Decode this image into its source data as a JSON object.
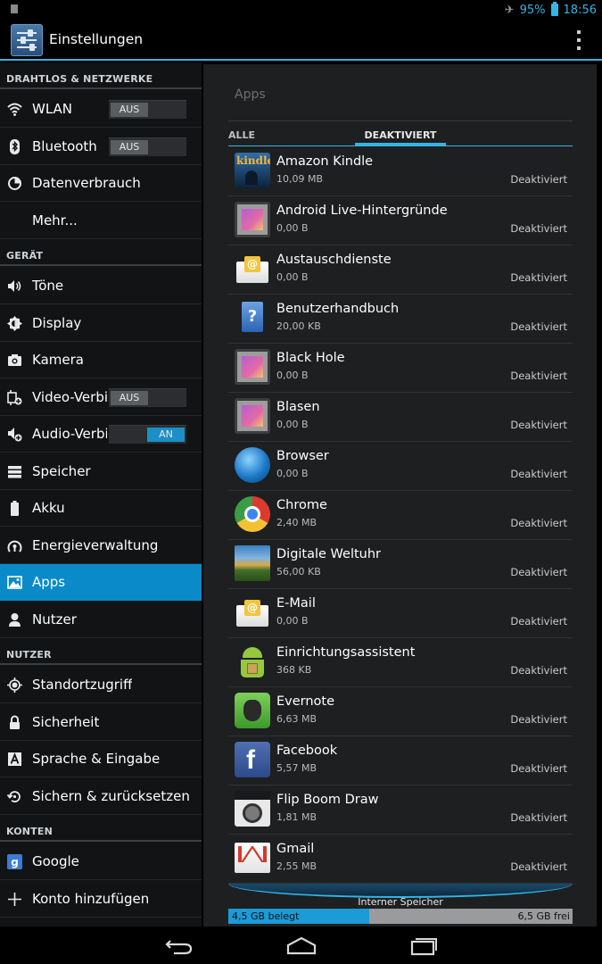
{
  "status_bar": {
    "battery": "95%",
    "time": "18:56",
    "icons": [
      "notification-icon",
      "airplane-mode-icon",
      "battery-icon"
    ]
  },
  "action_bar": {
    "title": "Einstellungen",
    "icons": [
      "settings-app-icon",
      "overflow-menu-icon"
    ]
  },
  "sidebar": {
    "sections": [
      {
        "header": "DRAHTLOS & NETZWERKE",
        "items": [
          {
            "label": "WLAN",
            "icon": "wifi-icon",
            "toggle": "AUS",
            "toggle_on": false
          },
          {
            "label": "Bluetooth",
            "icon": "bluetooth-icon",
            "toggle": "AUS",
            "toggle_on": false
          },
          {
            "label": "Datenverbrauch",
            "icon": "data-usage-icon"
          },
          {
            "label": "Mehr...",
            "icon": ""
          }
        ]
      },
      {
        "header": "GERÄT",
        "items": [
          {
            "label": "Töne",
            "icon": "sound-icon"
          },
          {
            "label": "Display",
            "icon": "display-icon"
          },
          {
            "label": "Kamera",
            "icon": "camera-icon"
          },
          {
            "label": "Video-Verbindung",
            "icon": "video-connection-icon",
            "toggle": "AUS",
            "toggle_on": false
          },
          {
            "label": "Audio-Verbindung",
            "icon": "audio-connection-icon",
            "toggle": "AN",
            "toggle_on": true
          },
          {
            "label": "Speicher",
            "icon": "storage-icon"
          },
          {
            "label": "Akku",
            "icon": "battery-icon"
          },
          {
            "label": "Energieverwaltung",
            "icon": "power-management-icon"
          },
          {
            "label": "Apps",
            "icon": "apps-icon",
            "active": true
          },
          {
            "label": "Nutzer",
            "icon": "user-icon"
          }
        ]
      },
      {
        "header": "NUTZER",
        "items": [
          {
            "label": "Standortzugriff",
            "icon": "location-icon"
          },
          {
            "label": "Sicherheit",
            "icon": "lock-icon"
          },
          {
            "label": "Sprache & Eingabe",
            "icon": "language-icon"
          },
          {
            "label": "Sichern & zurücksetzen",
            "icon": "backup-icon"
          }
        ]
      },
      {
        "header": "KONTEN",
        "items": [
          {
            "label": "Google",
            "icon": "google-icon"
          },
          {
            "label": "Konto hinzufügen",
            "icon": "plus-icon"
          }
        ]
      }
    ]
  },
  "main": {
    "title": "Apps",
    "tabs": [
      {
        "label": "ALLE",
        "selected": false
      },
      {
        "label": "DEAKTIVIERT",
        "selected": true
      }
    ],
    "apps": [
      {
        "name": "Amazon Kindle",
        "size": "10,09 MB",
        "status": "Deaktiviert",
        "icon": "kindle-icon",
        "icon_text": "kindle"
      },
      {
        "name": "Android Live-Hintergründe",
        "size": "0,00 B",
        "status": "Deaktiviert",
        "icon": "live-wallpaper-icon"
      },
      {
        "name": "Austauschdienste",
        "size": "0,00 B",
        "status": "Deaktiviert",
        "icon": "exchange-mail-icon"
      },
      {
        "name": "Benutzerhandbuch",
        "size": "20,00 KB",
        "status": "Deaktiviert",
        "icon": "user-guide-icon"
      },
      {
        "name": "Black Hole",
        "size": "0,00 B",
        "status": "Deaktiviert",
        "icon": "live-wallpaper-icon"
      },
      {
        "name": "Blasen",
        "size": "0,00 B",
        "status": "Deaktiviert",
        "icon": "live-wallpaper-icon"
      },
      {
        "name": "Browser",
        "size": "0,00 B",
        "status": "Deaktiviert",
        "icon": "browser-globe-icon"
      },
      {
        "name": "Chrome",
        "size": "2,40 MB",
        "status": "Deaktiviert",
        "icon": "chrome-icon"
      },
      {
        "name": "Digitale Weltuhr",
        "size": "56,00 KB",
        "status": "Deaktiviert",
        "icon": "world-clock-icon"
      },
      {
        "name": "E-Mail",
        "size": "0,00 B",
        "status": "Deaktiviert",
        "icon": "email-icon"
      },
      {
        "name": "Einrichtungsassistent",
        "size": "368 KB",
        "status": "Deaktiviert",
        "icon": "android-setup-icon"
      },
      {
        "name": "Evernote",
        "size": "6,63 MB",
        "status": "Deaktiviert",
        "icon": "evernote-icon"
      },
      {
        "name": "Facebook",
        "size": "5,57 MB",
        "status": "Deaktiviert",
        "icon": "facebook-icon"
      },
      {
        "name": "Flip Boom Draw",
        "size": "1,81 MB",
        "status": "Deaktiviert",
        "icon": "flip-boom-draw-icon"
      },
      {
        "name": "Gmail",
        "size": "2,55 MB",
        "status": "Deaktiviert",
        "icon": "gmail-icon"
      }
    ],
    "storage": {
      "label": "Interner Speicher",
      "used": "4,5 GB belegt",
      "free": "6,5 GB frei",
      "used_fraction": 0.41
    }
  },
  "nav_bar": {
    "icons": [
      "back-icon",
      "home-icon",
      "recent-apps-icon"
    ]
  },
  "colors": {
    "accent": "#33b5e5",
    "active_item": "#0a8ac8",
    "sidebar_bg": "#111315",
    "content_bg": "#1e1f21"
  }
}
